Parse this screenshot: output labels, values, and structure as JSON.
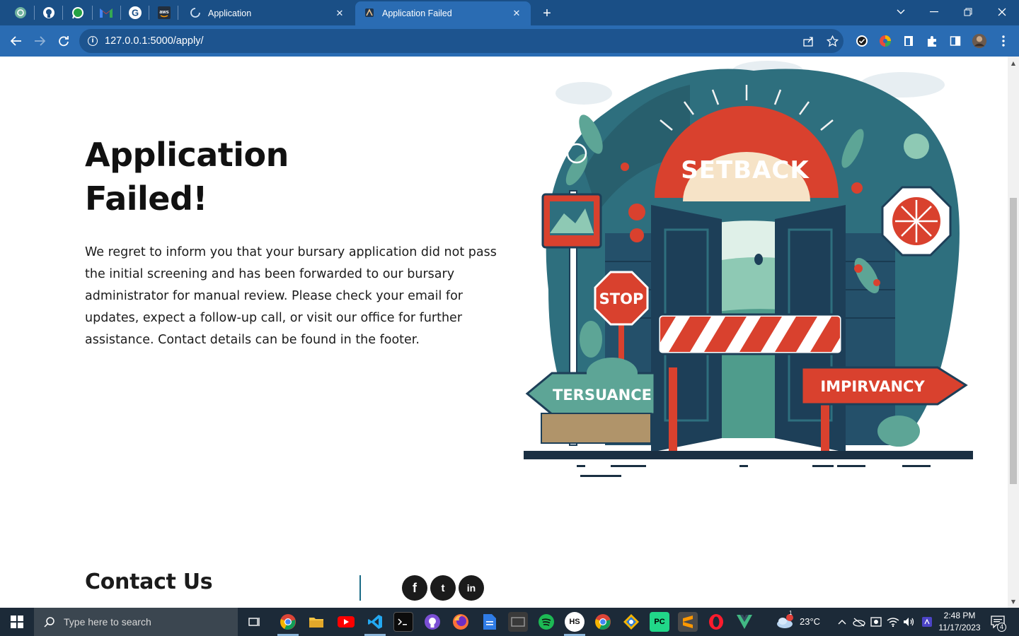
{
  "browser": {
    "tabs": [
      {
        "title": "Application",
        "loading": true,
        "active": false
      },
      {
        "title": "Application Failed",
        "loading": false,
        "active": true
      }
    ],
    "new_tab_label": "+",
    "url": "127.0.0.1:5000/apply/"
  },
  "page": {
    "title_line1": "Application",
    "title_line2": "Failed!",
    "message": "We regret to inform you that your bursary application did not pass the initial screening and has been forwarded to our bursary administrator for manual review. Please check your email for updates, expect a follow-up call, or visit our office for further assistance. Contact details can be found in the footer.",
    "illustration": {
      "headline": "SETBACK",
      "stop_sign": "STOP",
      "left_arrow": "TERSUANCE",
      "right_arrow": "IMPIRVANCY"
    },
    "footer": {
      "contact_heading": "Contact Us",
      "social": [
        {
          "name": "facebook-icon",
          "glyph": "f"
        },
        {
          "name": "twitter-icon",
          "glyph": "t"
        },
        {
          "name": "linkedin-icon",
          "glyph": "in"
        }
      ]
    }
  },
  "taskbar": {
    "search_placeholder": "Type here to search",
    "weather_temp": "23°C",
    "weather_badge": "1",
    "time": "2:48 PM",
    "date": "11/17/2023",
    "notification_count": "4"
  },
  "colors": {
    "chrome_dark": "#1a4f86",
    "chrome_light": "#2a6cb3",
    "accent_red": "#d9412e",
    "teal": "#2e6f7e"
  }
}
